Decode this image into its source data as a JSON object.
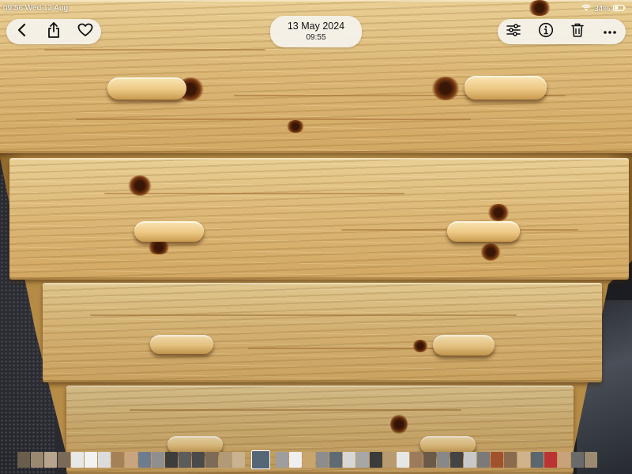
{
  "status_bar": {
    "time_date": "09:56  Wed 12 Aug",
    "wifi_icon": "wifi-icon",
    "battery_percent": "34%",
    "battery_icon": "battery-icon"
  },
  "header": {
    "date": "13 May 2024",
    "time": "09:55"
  },
  "toolbar_left": {
    "back_icon": "chevron-left-icon",
    "share_icon": "share-icon",
    "favorite_icon": "heart-icon"
  },
  "toolbar_right": {
    "adjust_icon": "sliders-icon",
    "info_icon": "info-icon",
    "delete_icon": "trash-icon",
    "more_icon": "ellipsis-icon"
  },
  "photo": {
    "subject": "wooden chest of drawers",
    "wood_color": "#dcb877",
    "handle_color": "#ecc884"
  },
  "filmstrip": {
    "thumbnail_colors": [
      "#6b5d4c",
      "#9a8870",
      "#b7a48d",
      "#7a6a57",
      "#e8e8e8",
      "#f2f2f2",
      "#dcdcdc",
      "#a68157",
      "#c9a57f",
      "#6d7c8e",
      "#8f8f8f",
      "#3d3d3d",
      "#5c5c5c",
      "#4a4a4a",
      "#7e6b57",
      "#b19a78",
      "#c8b28f",
      "#556677",
      "#9e9e9e",
      "#efefef",
      "#c9a56e",
      "#8d8d8d",
      "#5f6a75",
      "#d7d7d7",
      "#a7a7a7",
      "#3b3b3b",
      "#b89a70",
      "#e6e6e6",
      "#9b7b5b",
      "#6c5a48",
      "#888",
      "#444",
      "#c8c8c8",
      "#7a7a7a",
      "#a0522d",
      "#8a6b4e",
      "#d0b38a",
      "#5a6670",
      "#b33",
      "#c9a27a",
      "#6a6a6a",
      "#9c8a70"
    ],
    "selected_index": 17
  }
}
